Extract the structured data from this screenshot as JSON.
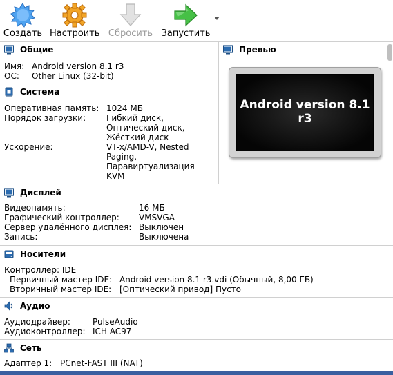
{
  "toolbar": {
    "create_label": "Создать",
    "settings_label": "Настроить",
    "discard_label": "Сбросить",
    "start_label": "Запустить"
  },
  "general": {
    "title": "Общие",
    "name_label": "Имя:",
    "name_value": "Android version 8.1 r3",
    "os_label": "ОС:",
    "os_value": "Other Linux (32-bit)"
  },
  "preview": {
    "title": "Превью",
    "screen_text_line1": "Android version 8.1",
    "screen_text_line2": "r3"
  },
  "system": {
    "title": "Система",
    "ram_label": "Оперативная память:",
    "ram_value": "1024 МБ",
    "boot_label": "Порядок загрузки:",
    "boot_values": [
      "Гибкий диск,",
      "Оптический диск,",
      "Жёсткий диск"
    ],
    "accel_label": "Ускорение:",
    "accel_values": [
      "VT-x/AMD-V, Nested",
      "Paging,",
      "Паравиртуализация",
      "KVM"
    ]
  },
  "display": {
    "title": "Дисплей",
    "vram_label": "Видеопамять:",
    "vram_value": "16 МБ",
    "gfx_label": "Графический контроллер:",
    "gfx_value": "VMSVGA",
    "rdp_label": "Сервер удалённого дисплея:",
    "rdp_value": "Выключен",
    "rec_label": "Запись:",
    "rec_value": "Выключена"
  },
  "storage": {
    "title": "Носители",
    "controller": "Контроллер: IDE",
    "primary_label": "Первичный мастер IDE:",
    "primary_value": "Android version 8.1 r3.vdi (Обычный, 8,00 ГБ)",
    "secondary_label": "Вторичный мастер IDE:",
    "secondary_value": "[Оптический привод] Пусто"
  },
  "audio": {
    "title": "Аудио",
    "driver_label": "Аудиодрайвер:",
    "driver_value": "PulseAudio",
    "controller_label": "Аудиоконтроллер:",
    "controller_value": "ICH AC97"
  },
  "network": {
    "title": "Сеть",
    "adapter_label": "Адаптер 1:",
    "adapter_value": "PCnet-FAST III (NAT)"
  },
  "icons": {
    "create": "new-vm-icon",
    "settings": "gear-icon",
    "discard": "discard-arrow-icon",
    "start": "start-arrow-icon"
  },
  "colors": {
    "start_green": "#3cb43c",
    "settings_orange": "#f0a020",
    "create_blue": "#3c8ce0"
  }
}
